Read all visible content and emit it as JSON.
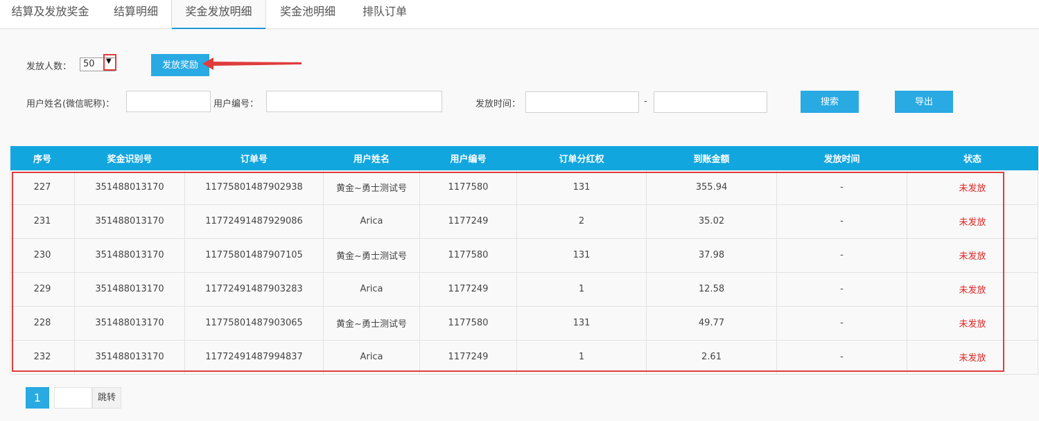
{
  "tabs": [
    {
      "label": "结算及发放奖金"
    },
    {
      "label": "结算明细"
    },
    {
      "label": "奖金发放明细"
    },
    {
      "label": "奖金池明细"
    },
    {
      "label": "排队订单"
    }
  ],
  "active_tab": 2,
  "form": {
    "issue_count_label": "发放人数：",
    "issue_count_value": "50",
    "issue_button": "发放奖励",
    "username_label": "用户姓名(微信昵称)：",
    "user_id_label": "用户编号：",
    "issue_time_label": "发放时间：",
    "date_separator": "-",
    "search_button": "搜索",
    "export_button": "导出"
  },
  "table": {
    "headers": [
      "序号",
      "奖金识别号",
      "订单号",
      "用户姓名",
      "用户编号",
      "订单分红权",
      "到账金额",
      "发放时间",
      "状态"
    ],
    "rows": [
      [
        "227",
        "351488013170",
        "11775801487902938",
        "黄金~勇士测试号",
        "1177580",
        "131",
        "355.94",
        "-",
        "未发放"
      ],
      [
        "231",
        "351488013170",
        "11772491487929086",
        "Arica",
        "1177249",
        "2",
        "35.02",
        "-",
        "未发放"
      ],
      [
        "230",
        "351488013170",
        "11775801487907105",
        "黄金~勇士测试号",
        "1177580",
        "131",
        "37.98",
        "-",
        "未发放"
      ],
      [
        "229",
        "351488013170",
        "11772491487903283",
        "Arica",
        "1177249",
        "1",
        "12.58",
        "-",
        "未发放"
      ],
      [
        "228",
        "351488013170",
        "11775801487903065",
        "黄金~勇士测试号",
        "1177580",
        "131",
        "49.77",
        "-",
        "未发放"
      ],
      [
        "232",
        "351488013170",
        "11772491487994837",
        "Arica",
        "1177249",
        "1",
        "2.61",
        "-",
        "未发放"
      ]
    ]
  },
  "pagination": {
    "current_page": "1",
    "jump_label": "跳转"
  },
  "colors": {
    "accent": "#29aae3",
    "header_bg": "#12a6df",
    "status_red": "#e02424",
    "annotation_red": "#e03c3c"
  }
}
